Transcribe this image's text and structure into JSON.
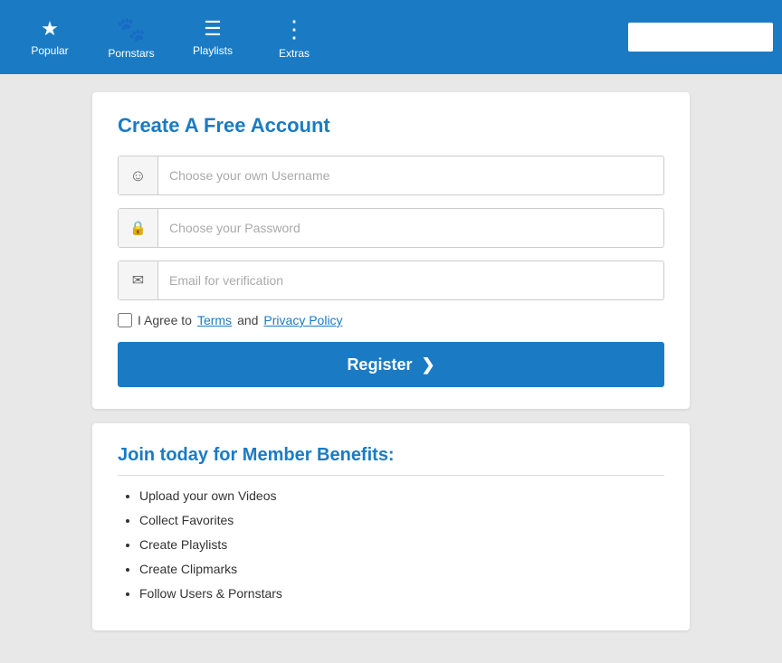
{
  "navbar": {
    "items": [
      {
        "id": "popular",
        "label": "Popular",
        "icon": "★"
      },
      {
        "id": "pornstars",
        "label": "Pornstars",
        "icon": "♟"
      },
      {
        "id": "playlists",
        "label": "Playlists",
        "icon": "☰"
      },
      {
        "id": "extras",
        "label": "Extras",
        "icon": "⋮"
      }
    ],
    "search_placeholder": ""
  },
  "register_form": {
    "title": "Create A Free Account",
    "username_placeholder": "Choose your own Username",
    "password_placeholder": "Choose your Password",
    "email_placeholder": "Email for verification",
    "agree_text": "I Agree to",
    "terms_label": "Terms",
    "and_text": "and",
    "privacy_label": "Privacy Policy",
    "register_button": "Register",
    "register_arrow": "❯"
  },
  "benefits": {
    "title": "Join today for Member Benefits:",
    "items": [
      "Upload your own Videos",
      "Collect Favorites",
      "Create Playlists",
      "Create Clipmarks",
      "Follow Users & Pornstars"
    ]
  }
}
